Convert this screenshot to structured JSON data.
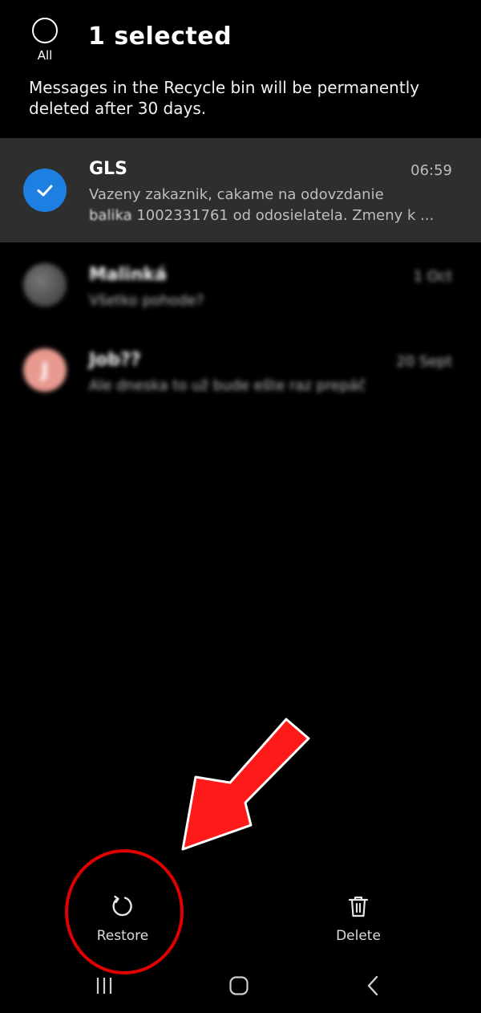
{
  "header": {
    "select_all_label": "All",
    "title": "1 selected",
    "notice": "Messages in the Recycle bin will be permanently deleted after 30 days."
  },
  "conversations": [
    {
      "name": "GLS",
      "time": "06:59",
      "snippet_line1": "Vazeny zakaznik, cakame na odovzdanie",
      "snippet_line2_blurred": "balika",
      "snippet_line2": " 1002331761 od odosielatela. Zmeny k ...",
      "selected": true
    },
    {
      "name": "Malinká",
      "time": "1 Oct",
      "snippet": "Všetko pohode?",
      "selected": false
    },
    {
      "name": "Job??",
      "time": "20 Sept",
      "snippet": "Ale dneska to už bude ešte raz prepáč",
      "avatar_letter": "J",
      "selected": false
    }
  ],
  "actions": {
    "restore_label": "Restore",
    "delete_label": "Delete"
  },
  "colors": {
    "accent": "#1e7fe3",
    "annotation": "#e00000",
    "selected_row": "#2e2e2e",
    "job_avatar": "#e89a90"
  },
  "icons": [
    "check-icon",
    "restore-icon",
    "trash-icon",
    "recents-icon",
    "home-icon",
    "back-icon"
  ]
}
